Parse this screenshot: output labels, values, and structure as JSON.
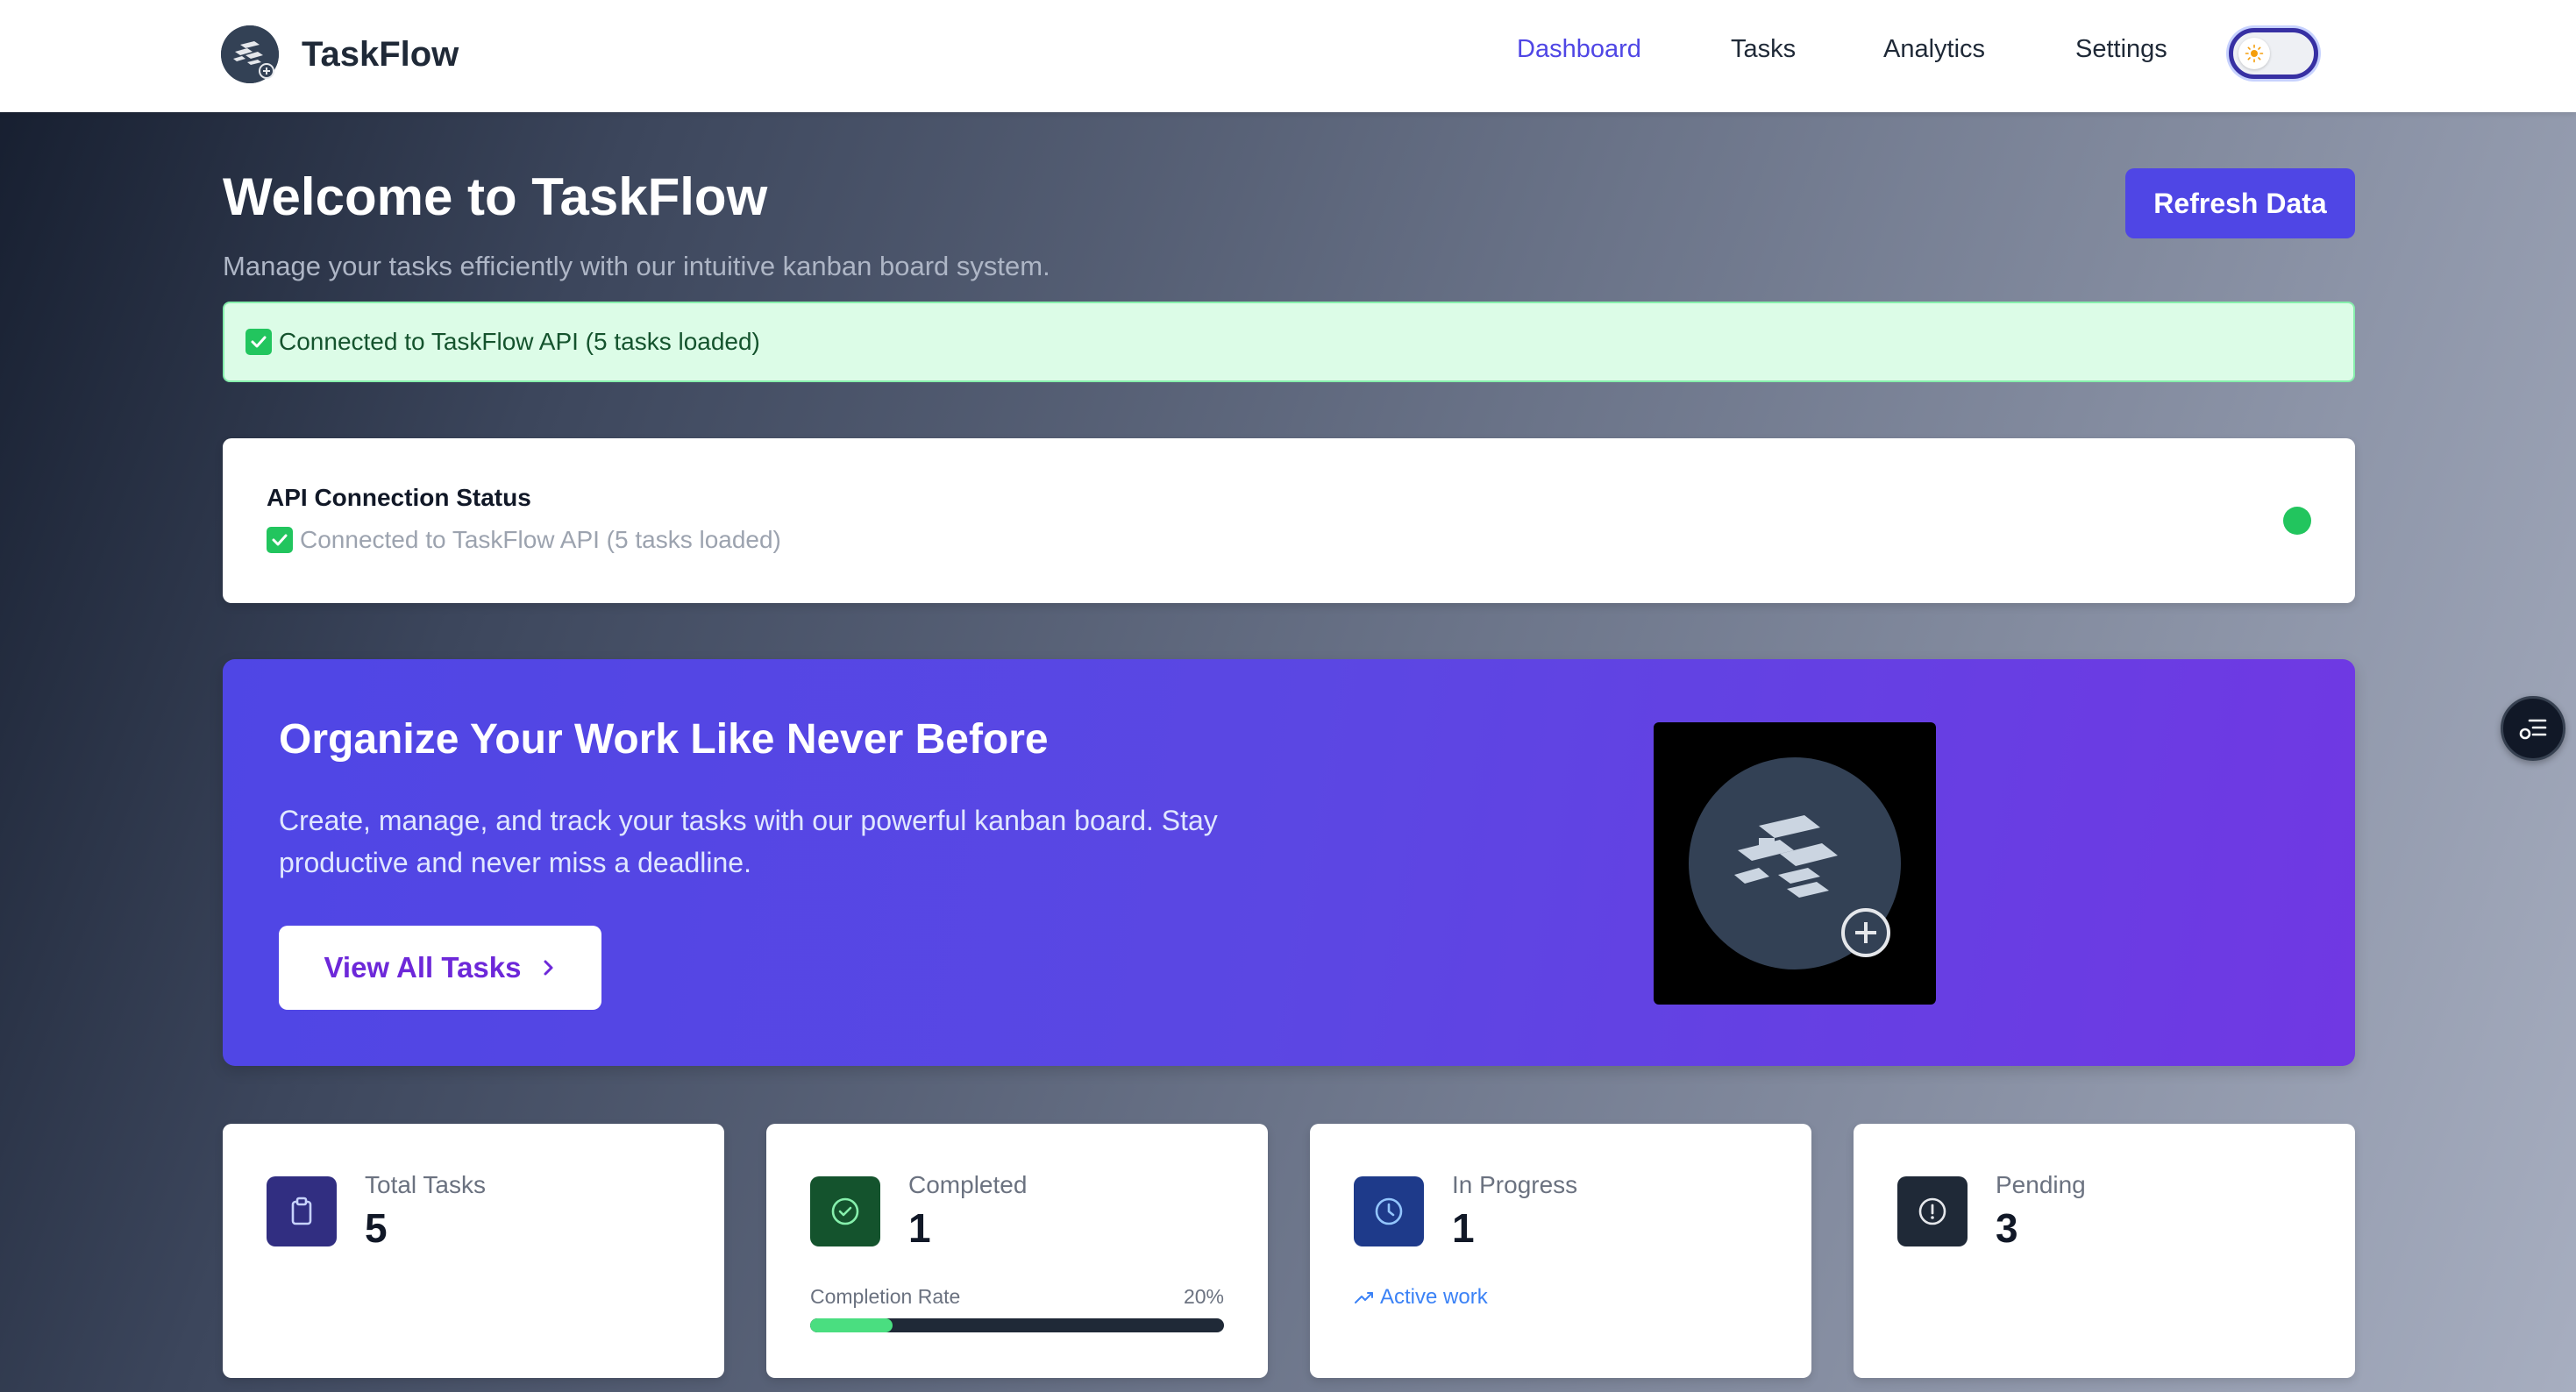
{
  "header": {
    "brand": "TaskFlow",
    "nav": [
      "Dashboard",
      "Tasks",
      "Analytics",
      "Settings"
    ],
    "active_nav": "Dashboard"
  },
  "welcome": {
    "title": "Welcome to TaskFlow",
    "subtitle": "Manage your tasks efficiently with our intuitive kanban board system.",
    "refresh_label": "Refresh Data"
  },
  "alert": {
    "text": "Connected to TaskFlow API (5 tasks loaded)"
  },
  "status_card": {
    "title": "API Connection Status",
    "text": "Connected to TaskFlow API (5 tasks loaded)",
    "indicator_color": "#22c55e"
  },
  "hero": {
    "title": "Organize Your Work Like Never Before",
    "text": "Create, manage, and track your tasks with our powerful kanban board. Stay productive and never miss a deadline.",
    "button_label": "View All Tasks"
  },
  "stats": [
    {
      "label": "Total Tasks",
      "value": "5",
      "icon": "clipboard-icon",
      "icon_bg": "#312e81",
      "icon_color": "#c7d2fe"
    },
    {
      "label": "Completed",
      "value": "1",
      "icon": "check-circle-icon",
      "icon_bg": "#14532d",
      "icon_color": "#86efac",
      "rate_label": "Completion Rate",
      "rate_text": "20%",
      "rate_fraction": 0.2
    },
    {
      "label": "In Progress",
      "value": "1",
      "icon": "clock-icon",
      "icon_bg": "#1e3a8a",
      "icon_color": "#93c5fd",
      "note": "Active work"
    },
    {
      "label": "Pending",
      "value": "3",
      "icon": "alert-circle-icon",
      "icon_bg": "#1f2937",
      "icon_color": "#e5e7eb"
    }
  ],
  "colors": {
    "accent": "#4f46e5",
    "success": "#22c55e"
  }
}
